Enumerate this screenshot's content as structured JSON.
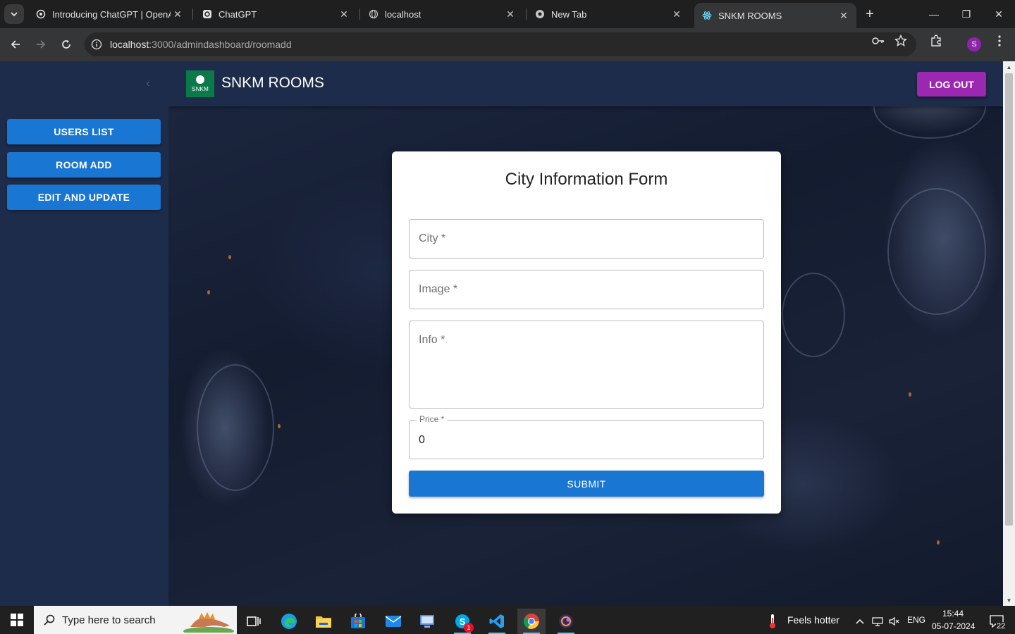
{
  "browser": {
    "tabs": [
      {
        "title": "Introducing ChatGPT | OpenAI",
        "icon": "openai-icon"
      },
      {
        "title": "ChatGPT",
        "icon": "openai-icon"
      },
      {
        "title": "localhost",
        "icon": "globe-icon"
      },
      {
        "title": "New Tab",
        "icon": "chrome-icon"
      },
      {
        "title": "SNKM ROOMS",
        "icon": "react-icon",
        "active": true
      }
    ],
    "url_host": "localhost",
    "url_path": ":3000/admindashboard/roomadd",
    "profile_initial": "S"
  },
  "sidebar": {
    "buttons": [
      {
        "label": "USERS LIST"
      },
      {
        "label": "ROOM ADD"
      },
      {
        "label": "EDIT AND UPDATE"
      }
    ]
  },
  "header": {
    "logo_text": "SNKM",
    "brand": "SNKM ROOMS",
    "logout_label": "LOG OUT"
  },
  "form": {
    "title": "City Information Form",
    "city_label": "City *",
    "image_label": "Image *",
    "info_label": "Info *",
    "price_label": "Price *",
    "price_value": "0",
    "submit_label": "SUBMIT"
  },
  "taskbar": {
    "search_placeholder": "Type here to search",
    "weather_text": "Feels hotter",
    "language": "ENG",
    "time": "15:44",
    "date": "05-07-2024",
    "notification_count": "22",
    "skype_badge": "1"
  },
  "colors": {
    "primary": "#1976d2",
    "logout": "#9c27b0",
    "appbar": "#1d2c4a",
    "logo_bg": "#0b7a4b"
  }
}
